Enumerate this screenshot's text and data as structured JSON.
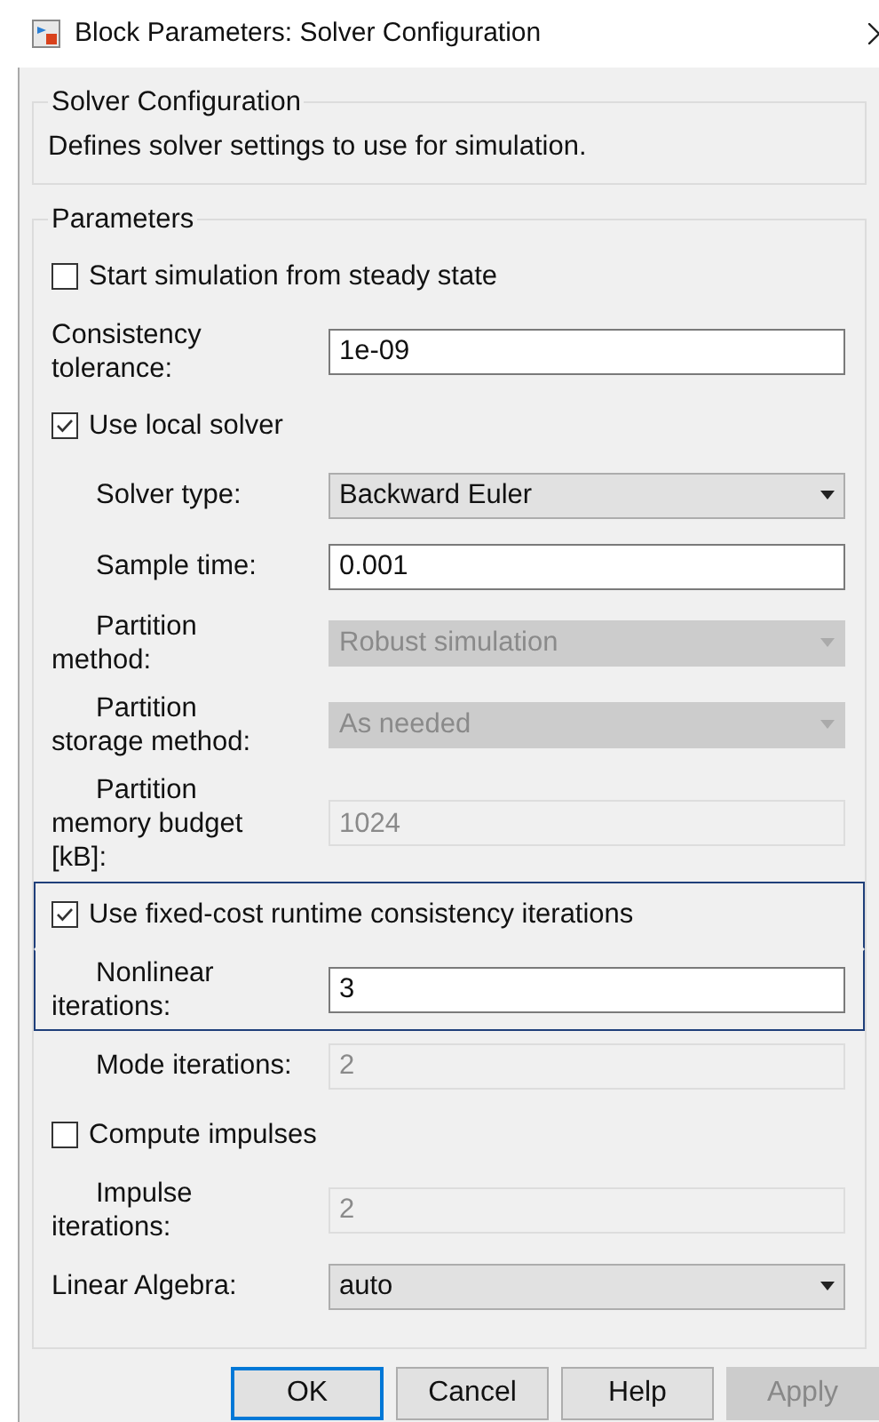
{
  "window": {
    "title": "Block Parameters: Solver Configuration"
  },
  "description_group": {
    "title": "Solver Configuration",
    "text": "Defines solver settings to use for simulation."
  },
  "parameters": {
    "title": "Parameters",
    "rows": [
      {
        "kind": "checkbox",
        "label": "Start simulation from steady state",
        "checked": false,
        "indented": false,
        "highlighted": false
      },
      {
        "kind": "text",
        "label": "Consistency tolerance:",
        "value": "1e-09",
        "disabled": false,
        "indented": false,
        "highlighted": false
      },
      {
        "kind": "checkbox",
        "label": "Use local solver",
        "checked": true,
        "indented": false,
        "highlighted": false
      },
      {
        "kind": "dropdown",
        "label": "Solver type:",
        "value": "Backward Euler",
        "disabled": false,
        "indented": true,
        "highlighted": false
      },
      {
        "kind": "text",
        "label": "Sample time:",
        "value": "0.001",
        "disabled": false,
        "indented": true,
        "highlighted": false
      },
      {
        "kind": "dropdown",
        "label": "Partition method:",
        "value": "Robust simulation",
        "disabled": true,
        "indented": true,
        "highlighted": false
      },
      {
        "kind": "dropdown",
        "label": "Partition storage method:",
        "value": "As needed",
        "disabled": true,
        "indented": true,
        "highlighted": false
      },
      {
        "kind": "text",
        "label": "Partition memory budget [kB]:",
        "value": "1024",
        "disabled": true,
        "indented": true,
        "highlighted": false
      },
      {
        "kind": "checkbox",
        "label": "Use fixed-cost runtime consistency iterations",
        "checked": true,
        "indented": false,
        "highlighted": true
      },
      {
        "kind": "text",
        "label": "Nonlinear iterations:",
        "value": "3",
        "disabled": false,
        "indented": true,
        "highlighted": true
      },
      {
        "kind": "text",
        "label": "Mode iterations:",
        "value": "2",
        "disabled": true,
        "indented": true,
        "highlighted": false
      },
      {
        "kind": "checkbox",
        "label": "Compute impulses",
        "checked": false,
        "indented": false,
        "highlighted": false
      },
      {
        "kind": "text",
        "label": "Impulse iterations:",
        "value": "2",
        "disabled": true,
        "indented": true,
        "highlighted": false
      },
      {
        "kind": "dropdown",
        "label": "Linear Algebra:",
        "value": "auto",
        "disabled": false,
        "indented": false,
        "highlighted": false
      }
    ]
  },
  "buttons": [
    {
      "label": "OK",
      "default": true,
      "disabled": false
    },
    {
      "label": "Cancel",
      "default": false,
      "disabled": false
    },
    {
      "label": "Help",
      "default": false,
      "disabled": false
    },
    {
      "label": "Apply",
      "default": false,
      "disabled": true
    }
  ]
}
